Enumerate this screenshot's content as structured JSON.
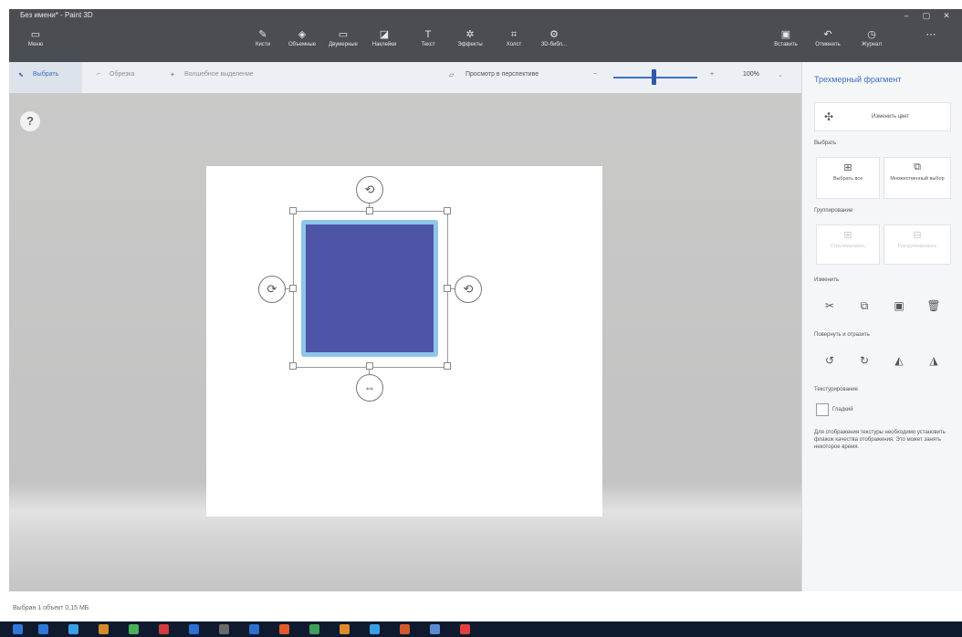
{
  "window": {
    "title": "Без имени* - Paint 3D"
  },
  "ribbon": {
    "left": [
      {
        "icon": "menu-icon",
        "label": "Меню"
      }
    ],
    "tools": [
      {
        "icon": "brushes-icon",
        "label": "Кисти"
      },
      {
        "icon": "shapes-3d-icon",
        "label": "Объемные"
      },
      {
        "icon": "shapes-2d-icon",
        "label": "Двумерные"
      },
      {
        "icon": "stickers-icon",
        "label": "Наклейки"
      },
      {
        "icon": "text-icon",
        "label": "Текст"
      },
      {
        "icon": "effects-icon",
        "label": "Эффекты"
      },
      {
        "icon": "canvas-icon",
        "label": "Холст"
      },
      {
        "icon": "library-icon",
        "label": "3D-библ..."
      }
    ],
    "right": [
      {
        "icon": "paste-icon",
        "label": "Вставить"
      },
      {
        "icon": "undo-icon",
        "label": "Отменить"
      },
      {
        "icon": "history-icon",
        "label": "Журнал"
      }
    ]
  },
  "subtoolbar": {
    "select": "Выбрать",
    "crop": "Обрезка",
    "magic_select": "Волшебное выделение",
    "perspective": "Просмотр в перспективе",
    "zoom": "100%",
    "zoom_value_percent": 100,
    "minus": "−",
    "plus": "+"
  },
  "canvas": {
    "help": "?",
    "shape_color": "#4f55a6",
    "outline_color": "#8fc5ea"
  },
  "panel": {
    "title": "Трехмерный фрагмент",
    "color_button": "Изменить цвет",
    "select_heading": "Выбрать",
    "select_all": "Выбрать все",
    "multi_select": "Множественный выбор",
    "group_heading": "Группирование",
    "group": "Сгруппировать",
    "ungroup": "Разгруппировать",
    "edit_heading": "Изменить",
    "rotate_heading": "Повернуть и отразить",
    "texture_heading": "Текстурирование",
    "smooth": "Гладкий",
    "description": "Для отображения текстуры необходимо установить флажок качества отображения. Это может занять некоторое время."
  },
  "status": {
    "text": "Выбран 1 объект 0,15 МБ"
  },
  "taskbar": {
    "colors": [
      "#2f78d8",
      "#3aa0e6",
      "#d68a2a",
      "#4ab05a",
      "#d23b3b",
      "#2f6fd0",
      "#6a6a6a",
      "#2f6fd0",
      "#e05a2a",
      "#3e9e5a",
      "#e08a2a",
      "#3aa0e6",
      "#d05a2a",
      "#5a8ad0",
      "#e04040"
    ]
  }
}
